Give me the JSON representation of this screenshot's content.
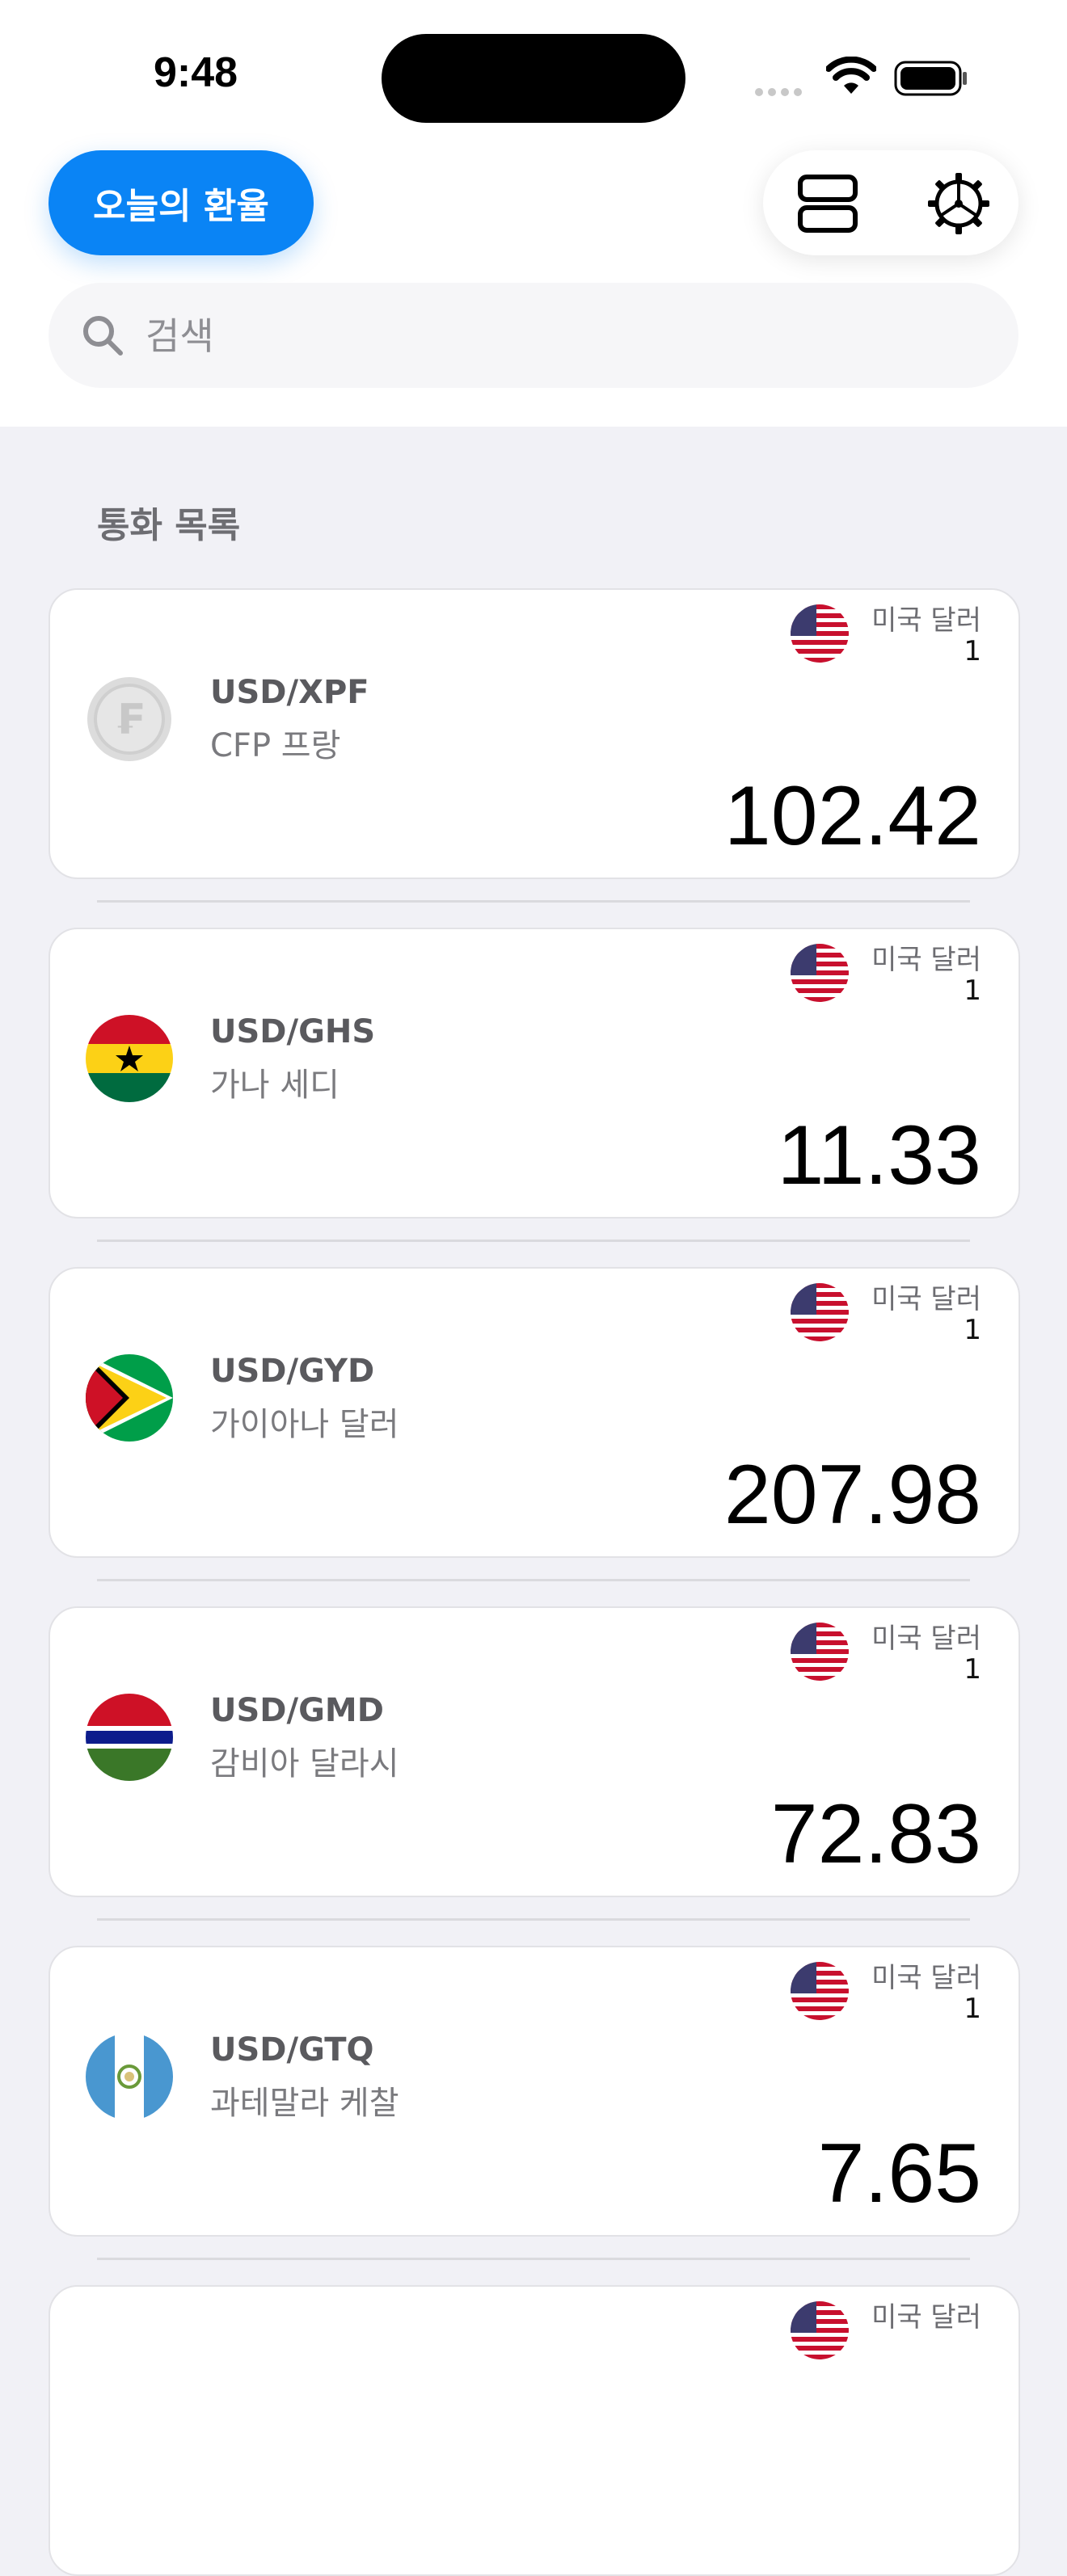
{
  "status_bar": {
    "time": "9:48"
  },
  "header": {
    "today_button_label": "오늘의 환율",
    "layout_icon": "stack-layout-icon",
    "settings_icon": "gear-icon"
  },
  "search": {
    "placeholder": "검색",
    "value": ""
  },
  "section": {
    "title": "통화 목록"
  },
  "rates": [
    {
      "pair": "USD/XPF",
      "name": "CFP 프랑",
      "base_name": "미국 달러",
      "base_amount": "1",
      "rate": "102.42",
      "flag_icon": "xpf-coin-icon"
    },
    {
      "pair": "USD/GHS",
      "name": "가나 세디",
      "base_name": "미국 달러",
      "base_amount": "1",
      "rate": "11.33",
      "flag_icon": "ghana-flag-icon"
    },
    {
      "pair": "USD/GYD",
      "name": "가이아나 달러",
      "base_name": "미국 달러",
      "base_amount": "1",
      "rate": "207.98",
      "flag_icon": "guyana-flag-icon"
    },
    {
      "pair": "USD/GMD",
      "name": "감비아 달라시",
      "base_name": "미국 달러",
      "base_amount": "1",
      "rate": "72.83",
      "flag_icon": "gambia-flag-icon"
    },
    {
      "pair": "USD/GTQ",
      "name": "과테말라 케찰",
      "base_name": "미국 달러",
      "base_amount": "1",
      "rate": "7.65",
      "flag_icon": "guatemala-flag-icon"
    },
    {
      "pair": "",
      "name": "",
      "base_name": "미국 달러",
      "base_amount": "",
      "rate": "",
      "flag_icon": ""
    }
  ],
  "colors": {
    "accent": "#0a84f5",
    "background": "#f1f1f6"
  }
}
